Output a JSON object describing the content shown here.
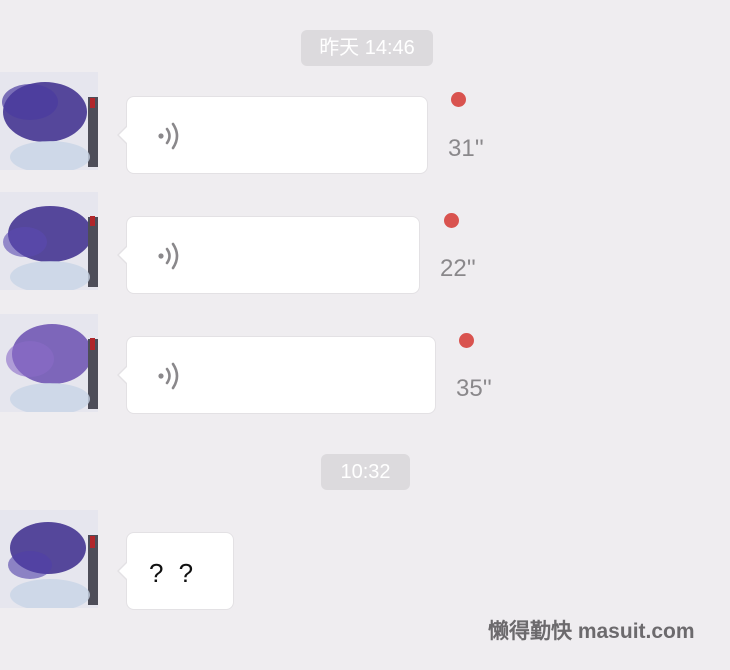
{
  "timestamps": {
    "first": "昨天 14:46",
    "second": "10:32"
  },
  "messages": [
    {
      "type": "voice",
      "duration": "31''",
      "icon": "voice-wave-icon",
      "unread": true
    },
    {
      "type": "voice",
      "duration": "22''",
      "icon": "voice-wave-icon",
      "unread": true
    },
    {
      "type": "voice",
      "duration": "35''",
      "icon": "voice-wave-icon",
      "unread": true
    },
    {
      "type": "text",
      "text": "? ?"
    }
  ],
  "watermark": "懒得勤快  masuit.com",
  "colors": {
    "background": "#efedf0",
    "bubble": "#ffffff",
    "unread_dot": "#d9534f",
    "timestamp_bg": "#dcdadd",
    "avatar_scribble": "#3b2a8c"
  }
}
